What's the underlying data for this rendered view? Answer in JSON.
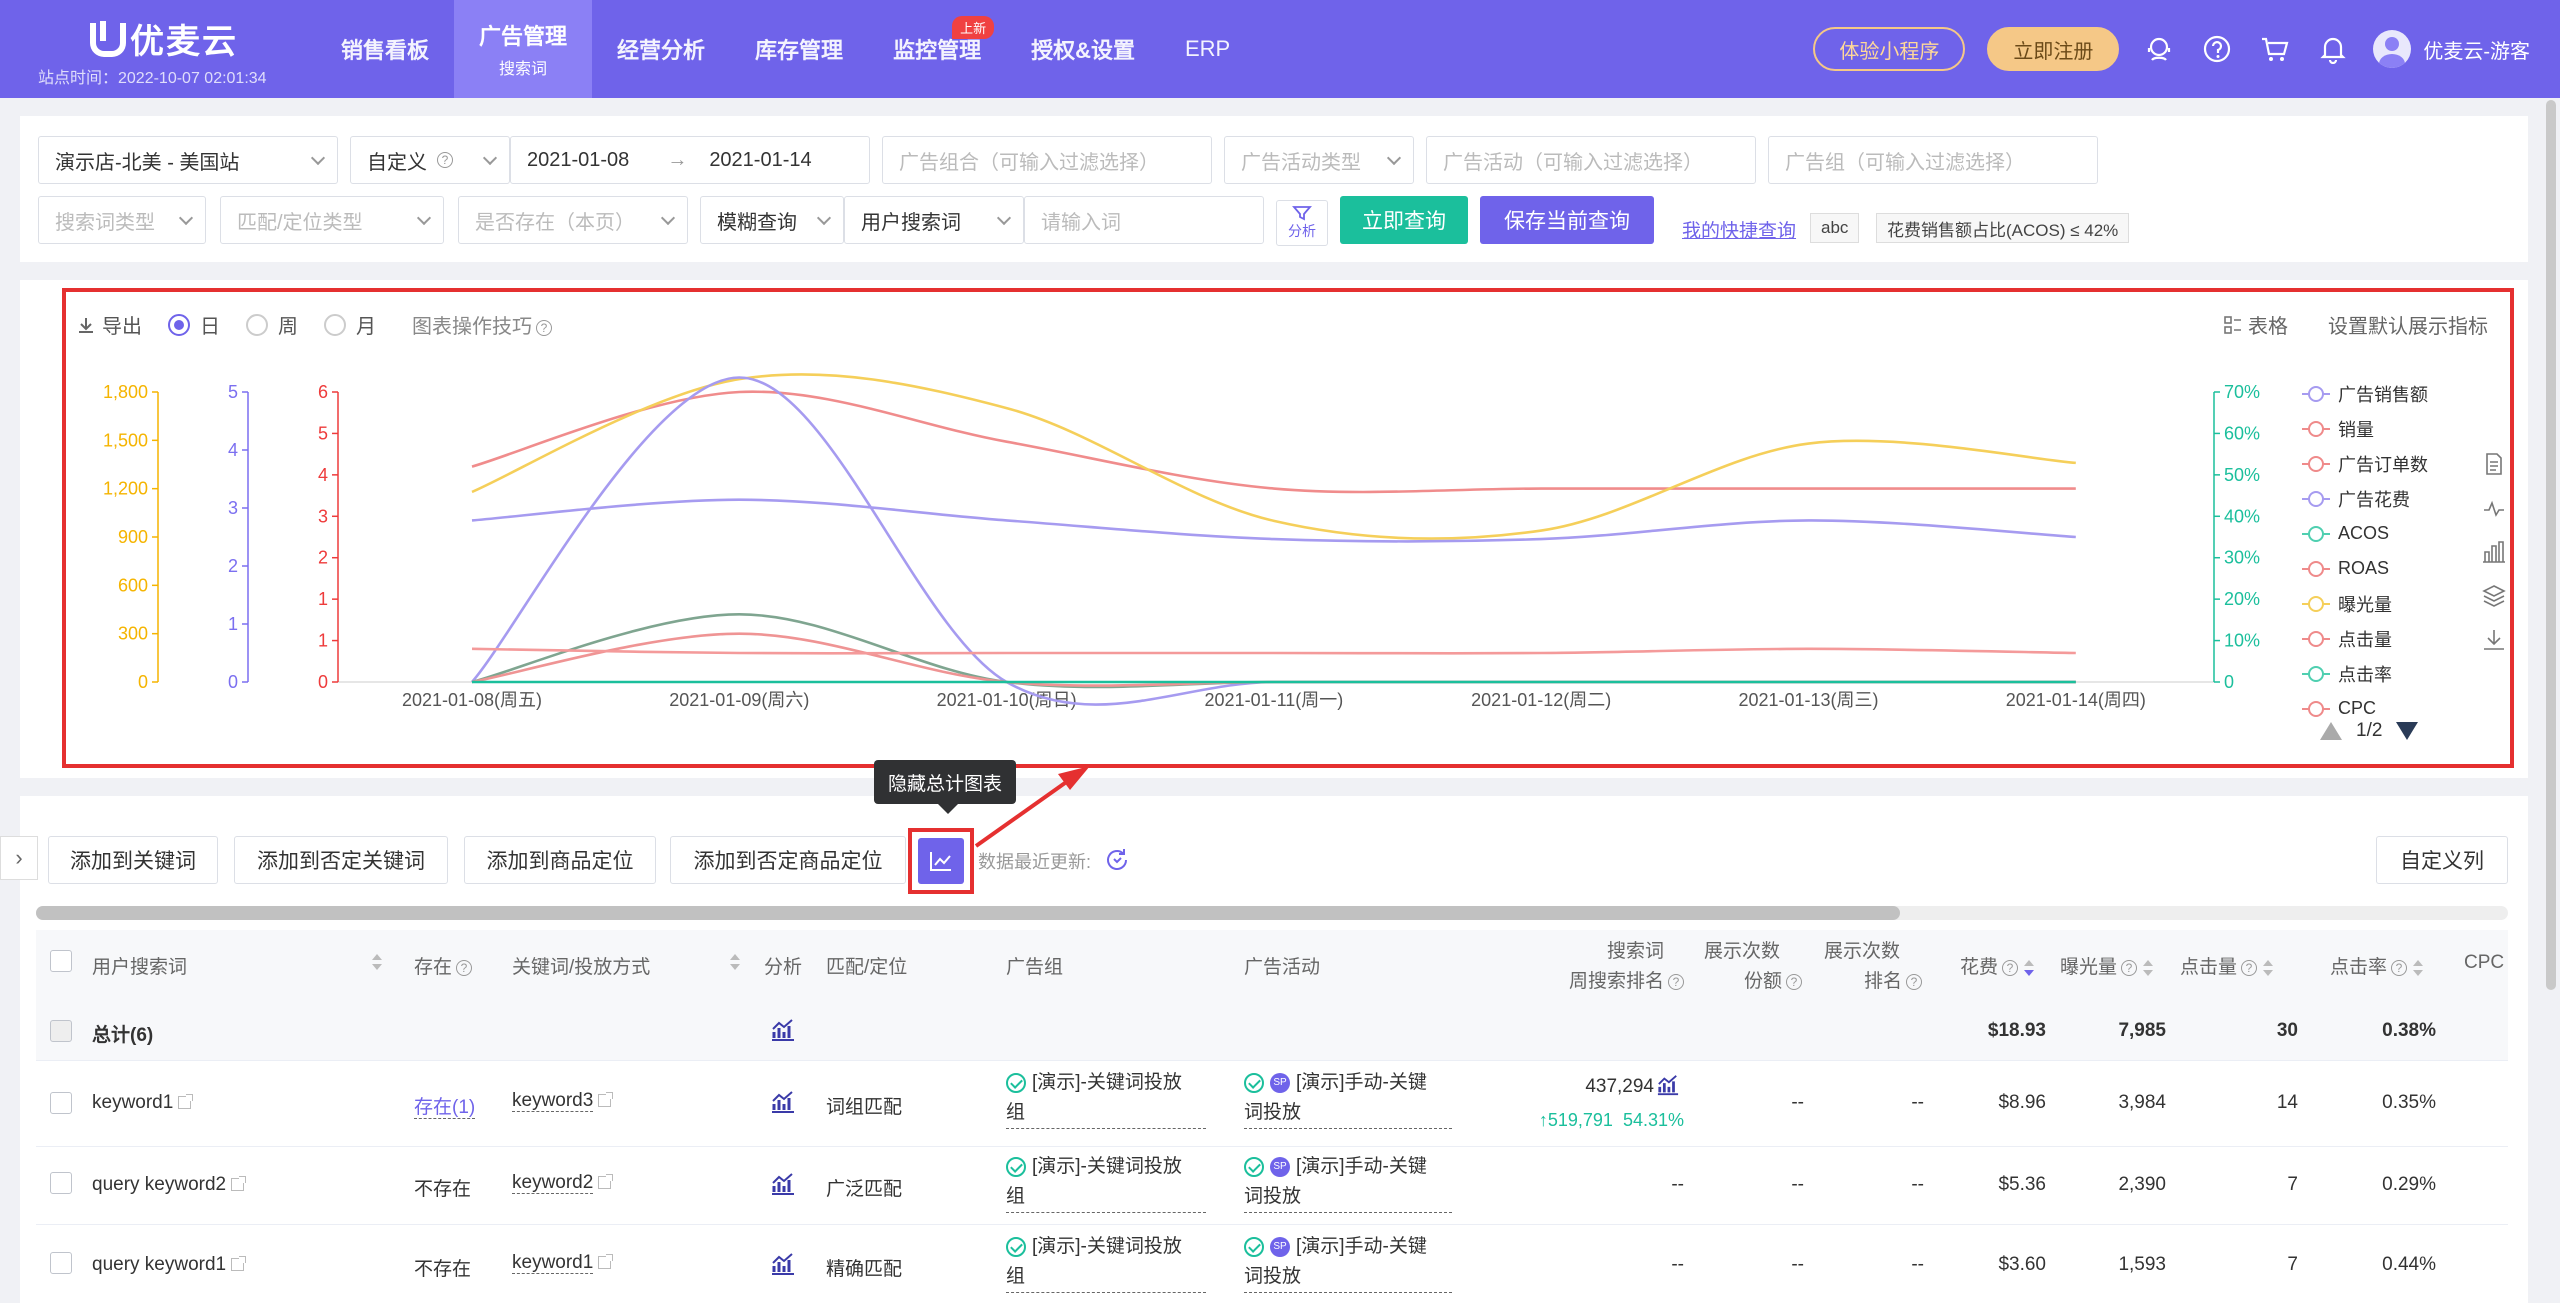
{
  "nav": {
    "logo": "优麦云",
    "site_time": "站点时间：2022-10-07 02:01:34",
    "items": [
      {
        "label": "销售看板"
      },
      {
        "label": "广告管理",
        "sub": "搜索词"
      },
      {
        "label": "经营分析"
      },
      {
        "label": "库存管理"
      },
      {
        "label": "监控管理",
        "badge": "上新"
      },
      {
        "label": "授权&设置"
      },
      {
        "label": "ERP"
      }
    ],
    "mini_program": "体验小程序",
    "register": "立即注册",
    "user": "优麦云-游客"
  },
  "filters": {
    "store": "演示店-北美 - 美国站",
    "date_mode": "自定义",
    "date_start": "2021-01-08",
    "date_arrow": "→",
    "date_end": "2021-01-14",
    "ad_portfolio_ph": "广告组合（可输入过滤选择）",
    "campaign_type_ph": "广告活动类型",
    "campaign_ph": "广告活动（可输入过滤选择）",
    "ad_group_ph": "广告组（可输入过滤选择）",
    "search_term_type_ph": "搜索词类型",
    "match_type_ph": "匹配/定位类型",
    "exists_ph": "是否存在（本页）",
    "fuzzy": "模糊查询",
    "search_field": "用户搜索词",
    "keyword_ph": "请输入词",
    "analyze": "分析",
    "query_btn": "立即查询",
    "save_btn": "保存当前查询",
    "quick_query": "我的快捷查询",
    "tag1": "abc",
    "tag2": "花费销售额占比(ACOS) ≤ 42%"
  },
  "chart_toolbar": {
    "export": "导出",
    "day": "日",
    "week": "周",
    "month": "月",
    "tips": "图表操作技巧",
    "table": "表格",
    "default_metrics": "设置默认展示指标"
  },
  "legend": {
    "items": [
      {
        "label": "广告销售额",
        "color": "#a69bf0"
      },
      {
        "label": "销量",
        "color": "#ef8a8a"
      },
      {
        "label": "广告订单数",
        "color": "#ef8a8a"
      },
      {
        "label": "广告花费",
        "color": "#a69bf0"
      },
      {
        "label": "ACOS",
        "color": "#4fcfb0"
      },
      {
        "label": "ROAS",
        "color": "#ef8a8a"
      },
      {
        "label": "曝光量",
        "color": "#f5cf5a"
      },
      {
        "label": "点击量",
        "color": "#ef8a8a"
      },
      {
        "label": "点击率",
        "color": "#4fcfb0"
      },
      {
        "label": "CPC",
        "color": "#ef8a8a"
      }
    ],
    "page": "1/2"
  },
  "chart_data": {
    "type": "line",
    "categories": [
      "2021-01-08(周五)",
      "2021-01-09(周六)",
      "2021-01-10(周日)",
      "2021-01-11(周一)",
      "2021-01-12(周二)",
      "2021-01-13(周三)",
      "2021-01-14(周四)"
    ],
    "axes": [
      {
        "ticks": [
          "0",
          "300",
          "600",
          "900",
          "1,200",
          "1,500",
          "1,800"
        ],
        "max": 1800,
        "color": "#f5b400"
      },
      {
        "ticks": [
          "0",
          "1",
          "2",
          "3",
          "4",
          "5"
        ],
        "max": 5,
        "color": "#7b6ff0"
      },
      {
        "ticks": [
          "0",
          "1",
          "1",
          "2",
          "3",
          "4",
          "5",
          "6"
        ],
        "max": 6,
        "color": "#ee3b3b"
      },
      {
        "ticks": [
          "0",
          "10%",
          "20%",
          "30%",
          "40%",
          "50%",
          "60%",
          "70%"
        ],
        "max": 70,
        "color": "#1bbf9c"
      }
    ],
    "series": [
      {
        "axis": 3,
        "color": "#f08c8c",
        "values": [
          52,
          70,
          58,
          46.7,
          46.7,
          46.7,
          46.7
        ]
      },
      {
        "axis": 0,
        "color": "#f5cf5a",
        "values": [
          1180,
          1880,
          1700,
          1000,
          940,
          1480,
          1360
        ]
      },
      {
        "axis": 3,
        "color": "#a69bf0",
        "values": [
          39,
          44,
          39,
          34.5,
          34.5,
          39,
          35
        ]
      },
      {
        "axis": 1,
        "color": "#a69bf0",
        "values": [
          0,
          5.4,
          0,
          0,
          0,
          0,
          0
        ]
      },
      {
        "axis": 2,
        "color": "#7fa590",
        "values": [
          0,
          1.4,
          0,
          0,
          0,
          0,
          0
        ]
      },
      {
        "axis": 2,
        "color": "#ef9494",
        "values": [
          0,
          1.0,
          0,
          0,
          0,
          0,
          0
        ]
      },
      {
        "axis": 3,
        "color": "#f49a9a",
        "values": [
          8,
          7,
          7,
          7,
          7,
          8,
          7
        ]
      },
      {
        "axis": 3,
        "color": "#1bbf9c",
        "values": [
          0,
          0,
          0,
          0,
          0,
          0,
          0
        ]
      }
    ]
  },
  "tooltip": "隐藏总计图表",
  "actions": {
    "add_keyword": "添加到关键词",
    "add_neg_keyword": "添加到否定关键词",
    "add_target": "添加到商品定位",
    "add_neg_target": "添加到否定商品定位",
    "data_update": "数据最近更新:",
    "custom_cols": "自定义列"
  },
  "table": {
    "headers": {
      "search_term": "用户搜索词",
      "exists": "存在",
      "keyword": "关键词/投放方式",
      "analyze": "分析",
      "match": "匹配/定位",
      "ad_group": "广告组",
      "campaign": "广告活动",
      "sfr_line1": "搜索词",
      "sfr_line2": "周搜索排名",
      "impr_share_line1": "展示次数",
      "impr_share_line2": "份额",
      "impr_rank_line1": "展示次数",
      "impr_rank_line2": "排名",
      "spend": "花费",
      "impressions": "曝光量",
      "clicks": "点击量",
      "ctr": "点击率",
      "cpc": "CPC"
    },
    "total": {
      "label": "总计(6)",
      "spend": "$18.93",
      "impressions": "7,985",
      "clicks": "30",
      "ctr": "0.38%"
    },
    "rows": [
      {
        "term": "keyword1",
        "exists": "存在(1)",
        "keyword": "keyword3",
        "match": "词组匹配",
        "ad_group_1": "[演示]-关键词投放",
        "ad_group_2": "组",
        "campaign_1": "[演示]手动-关键",
        "campaign_2": "词投放",
        "rank": "437,294",
        "rank_up": "519,791",
        "rank_pct": "54.31%",
        "share": "--",
        "irank": "--",
        "spend": "$8.96",
        "impressions": "3,984",
        "clicks": "14",
        "ctr": "0.35%"
      },
      {
        "term": "query keyword2",
        "exists": "不存在",
        "keyword": "keyword2",
        "match": "广泛匹配",
        "ad_group_1": "[演示]-关键词投放",
        "ad_group_2": "组",
        "campaign_1": "[演示]手动-关键",
        "campaign_2": "词投放",
        "rank": "--",
        "share": "--",
        "irank": "--",
        "spend": "$5.36",
        "impressions": "2,390",
        "clicks": "7",
        "ctr": "0.29%"
      },
      {
        "term": "query keyword1",
        "exists": "不存在",
        "keyword": "keyword1",
        "match": "精确匹配",
        "ad_group_1": "[演示]-关键词投放",
        "ad_group_2": "组",
        "campaign_1": "[演示]手动-关键",
        "campaign_2": "词投放",
        "rank": "--",
        "share": "--",
        "irank": "--",
        "spend": "$3.60",
        "impressions": "1,593",
        "clicks": "7",
        "ctr": "0.44%"
      }
    ]
  }
}
